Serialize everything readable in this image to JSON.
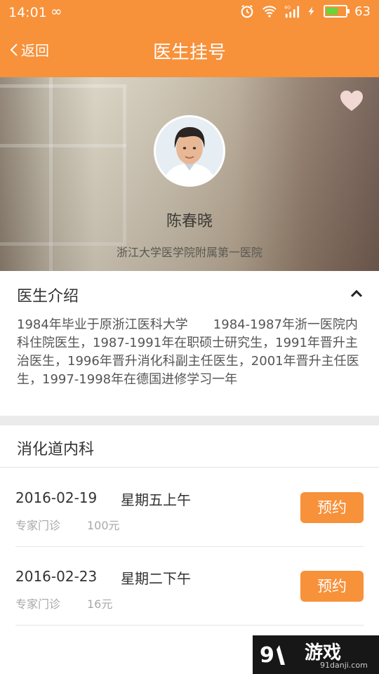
{
  "status_bar": {
    "time": "14:01",
    "loop_glyph": "∞",
    "signal_label": "4G",
    "battery_percent": "63",
    "battery_level": 0.63,
    "icons": [
      "alarm-icon",
      "wifi-icon",
      "signal-icon",
      "charging-icon",
      "battery-icon"
    ]
  },
  "header": {
    "back_label": "返回",
    "title": "医生挂号"
  },
  "doctor": {
    "name": "陈春晓",
    "hospital": "浙江大学医学院附属第一医院",
    "favorite_icon": "heart-icon"
  },
  "intro": {
    "heading": "医生介绍",
    "toggle_icon": "chevron-up-icon",
    "text": "1984年毕业于原浙江医科大学　　1984-1987年浙一医院内科住院医生，1987-1991年在职硕士研究生，1991年晋升主治医生，1996年晋升消化科副主任医生，2001年晋升主任医生，1997-1998年在德国进修学习一年"
  },
  "department": "消化道内科",
  "schedule": [
    {
      "date": "2016-02-19",
      "day": "星期五上午",
      "type": "专家门诊",
      "price": "100元",
      "button": "预约"
    },
    {
      "date": "2016-02-23",
      "day": "星期二下午",
      "type": "专家门诊",
      "price": "16元",
      "button": "预约"
    }
  ],
  "watermark": {
    "brand": "游戏",
    "site": "91danji.com"
  },
  "colors": {
    "accent": "#f7913a",
    "battery": "#6bd33d"
  }
}
